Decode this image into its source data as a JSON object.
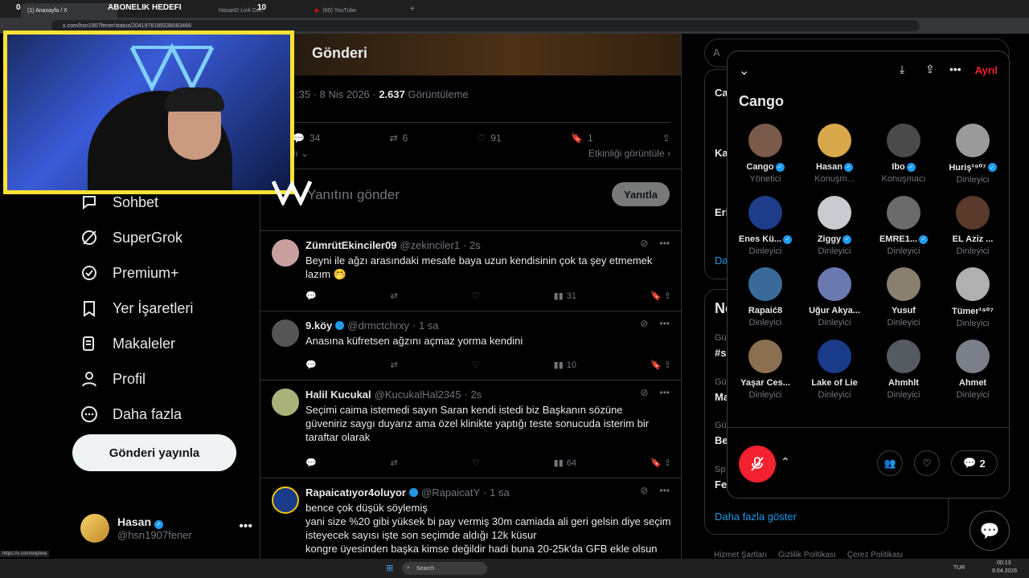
{
  "browser": {
    "tabs": [
      {
        "label": "(1) Anasayfa / X"
      },
      {
        "label": "HasanD Link Deh"
      },
      {
        "label": "(60) YouTube"
      }
    ],
    "url": "x.com/hsn1907fener/status/2041978189338083466",
    "status_url": "https://x.com/explore",
    "overlay_left_count": "0",
    "overlay_title": "ABONELIK HEDEFI",
    "overlay_right_count": "10"
  },
  "nav": {
    "items": [
      {
        "label": "Sohbet",
        "icon": "chat-icon"
      },
      {
        "label": "SuperGrok",
        "icon": "grok-icon"
      },
      {
        "label": "Premium+",
        "icon": "premium-icon"
      },
      {
        "label": "Yer İşaretleri",
        "icon": "bookmark-icon"
      },
      {
        "label": "Makaleler",
        "icon": "article-icon"
      },
      {
        "label": "Profil",
        "icon": "profile-icon"
      },
      {
        "label": "Daha fazla",
        "icon": "more-icon"
      }
    ],
    "post_button": "Gönderi yayınla",
    "account": {
      "name": "Hasan",
      "handle": "@hsn1907fener"
    }
  },
  "post": {
    "header": "Gönderi",
    "time": ":35 · 8 Nis 2026 · ",
    "views": "2.637",
    "views_label": "Görüntüleme",
    "replies": "34",
    "reposts": "6",
    "likes": "91",
    "bookmarks": "1",
    "sort_label": "alı",
    "activity_label": "Etkinliği görüntüle",
    "reply_placeholder": "Yanıtını gönder",
    "reply_button": "Yanıtla"
  },
  "replies": [
    {
      "name": "ZümrütEkinciler09",
      "handle": "@zekinciler1",
      "time": "· 2s",
      "verified": false,
      "text": "Beyni ile ağzı arasındaki mesafe baya uzun kendisinin  çok ta şey etmemek lazım 🤭",
      "views": "31"
    },
    {
      "name": "9.köy",
      "handle": "@drmctchrxy",
      "time": "· 1 sa",
      "verified": true,
      "text": "Anasına küfretsen ağzını açmaz yorma kendini",
      "views": "10"
    },
    {
      "name": "Halil Kucukal",
      "handle": "@KucukalHal2345",
      "time": "· 2s",
      "verified": false,
      "text": "Seçimi caima istemedi sayın Saran kendi istedi biz Başkanın sözüne güveniriz saygı duyarız ama özel klinikte yaptığı teste sonucuda isterim bir taraftar olarak",
      "views": "64"
    },
    {
      "name": "Rapaicatıyor4oluyor",
      "handle": "@RapaicatY",
      "time": "· 1 sa",
      "verified": true,
      "text": "bence çok düşük söylemiş\nyani size %20 gibi yüksek bi pay vermiş 30m camiada ali geri gelsin diye seçim isteyecek sayısı işte son seçimde aldığı 12k küsur\nkongre üyesinden başka kimse değildir hadi buna 20-25k'da GFB ekle olsun",
      "views": ""
    }
  ],
  "sidebar": {
    "search_letter": "A",
    "partial_lines": [
      "Ca",
      "Ka",
      "Erl",
      "Da",
      "No",
      "Gü",
      "#s",
      "Gü",
      "Ma",
      "Gü",
      "Be",
      "Sp",
      "Fe"
    ],
    "show_more": "Daha fazla göster",
    "footer": [
      "Hizmet Şartları",
      "Gizlilik Politikası",
      "Çerez Politikası"
    ]
  },
  "space": {
    "title": "Cango",
    "leave": "Ayrıl",
    "comment_count": "2",
    "participants": [
      {
        "name": "Cango",
        "role": "Yönetici",
        "verified": true,
        "color": "#7a5a4a"
      },
      {
        "name": "Hasan",
        "role": "Konuşm...",
        "verified": true,
        "color": "#d9a84a"
      },
      {
        "name": "Ibo",
        "role": "Konuşmacı",
        "verified": true,
        "color": "#4a4a4a"
      },
      {
        "name": "Huriş¹⁹⁰⁷",
        "role": "Dinleyici",
        "verified": true,
        "color": "#9a9a9a"
      },
      {
        "name": "Enes Kü...",
        "role": "Dinleyici",
        "verified": true,
        "color": "#1e3c8a"
      },
      {
        "name": "Ziggy",
        "role": "Dinleyici",
        "verified": true,
        "color": "#c8ccd0"
      },
      {
        "name": "EMRE1...",
        "role": "Dinleyici",
        "verified": true,
        "color": "#6b6b6b"
      },
      {
        "name": "EL Aziz ...",
        "role": "Dinleyici",
        "verified": false,
        "color": "#5a3a2a"
      },
      {
        "name": "Rapaić8",
        "role": "Dinleyici",
        "verified": false,
        "color": "#3a6a9a"
      },
      {
        "name": "Uğur Akya...",
        "role": "Dinleyici",
        "verified": false,
        "color": "#6a7ab0"
      },
      {
        "name": "Yusuf",
        "role": "Dinleyici",
        "verified": false,
        "color": "#8a8070"
      },
      {
        "name": "Tümer¹⁹⁰⁷",
        "role": "Dinleyici",
        "verified": false,
        "color": "#b0b0b0"
      },
      {
        "name": "Yaşar Ces...",
        "role": "Dinleyici",
        "verified": false,
        "color": "#8a7050"
      },
      {
        "name": "Lake of Lie",
        "role": "Dinleyici",
        "verified": false,
        "color": "#1a3a8a"
      },
      {
        "name": "Ahmhlt",
        "role": "Dinleyici",
        "verified": false,
        "color": "#555a60"
      },
      {
        "name": "Ahmet",
        "role": "Dinleyici",
        "verified": false,
        "color": "#7a7f88"
      }
    ]
  },
  "taskbar": {
    "search": "Search",
    "lang": "TUR",
    "time": "00:13",
    "date": "9.04.2026"
  }
}
